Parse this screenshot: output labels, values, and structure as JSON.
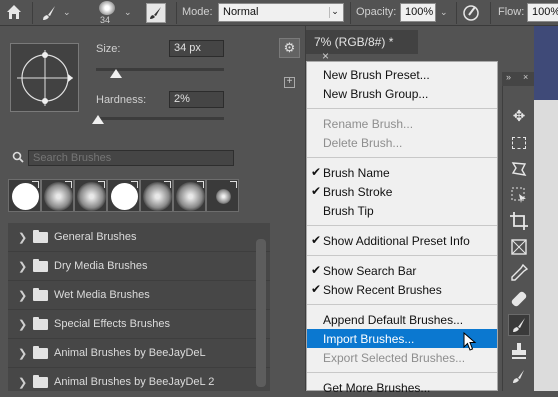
{
  "options_bar": {
    "size_value": "34",
    "mode_label": "Mode:",
    "mode_value": "Normal",
    "opacity_label": "Opacity:",
    "opacity_value": "100%",
    "flow_label": "Flow:",
    "flow_value": "100%"
  },
  "brush_panel": {
    "size_label": "Size:",
    "size_value": "34 px",
    "hardness_label": "Hardness:",
    "hardness_value": "2%",
    "search_placeholder": "Search Brushes",
    "groups": [
      {
        "name": "General Brushes"
      },
      {
        "name": "Dry Media Brushes"
      },
      {
        "name": "Wet Media Brushes"
      },
      {
        "name": "Special Effects Brushes"
      },
      {
        "name": "Animal Brushes by BeeJayDeL"
      },
      {
        "name": "Animal Brushes by BeeJayDeL 2"
      }
    ]
  },
  "document_tab": {
    "title": "7% (RGB/8#) *",
    "close": "×"
  },
  "context_menu": {
    "items": [
      {
        "label": "New Brush Preset...",
        "checked": false,
        "disabled": false
      },
      {
        "label": "New Brush Group...",
        "checked": false,
        "disabled": false
      },
      {
        "label": "Rename Brush...",
        "checked": false,
        "disabled": true
      },
      {
        "label": "Delete Brush...",
        "checked": false,
        "disabled": true
      },
      {
        "label": "Brush Name",
        "checked": true,
        "disabled": false
      },
      {
        "label": "Brush Stroke",
        "checked": true,
        "disabled": false
      },
      {
        "label": "Brush Tip",
        "checked": false,
        "disabled": false
      },
      {
        "label": "Show Additional Preset Info",
        "checked": true,
        "disabled": false
      },
      {
        "label": "Show Search Bar",
        "checked": true,
        "disabled": false
      },
      {
        "label": "Show Recent Brushes",
        "checked": true,
        "disabled": false
      },
      {
        "label": "Append Default Brushes...",
        "checked": false,
        "disabled": false
      },
      {
        "label": "Import Brushes...",
        "checked": false,
        "disabled": false,
        "highlighted": true
      },
      {
        "label": "Export Selected Brushes...",
        "checked": false,
        "disabled": true
      },
      {
        "label": "Get More Brushes...",
        "checked": false,
        "disabled": false
      }
    ],
    "check_glyph": "✔"
  },
  "colors": {
    "accent": "#0b78d0",
    "panel": "#535353",
    "menu": "#f0f0f0"
  }
}
